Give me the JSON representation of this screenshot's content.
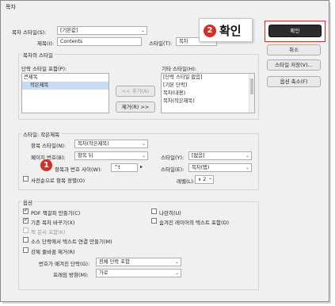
{
  "window": {
    "title": "목차"
  },
  "top": {
    "toc_style_label": "목차 스타일(S):",
    "toc_style_value": "[기본값]",
    "title_label": "제목(I):",
    "title_value": "Contents",
    "style_label": "스타일(T):",
    "style_value": "목차"
  },
  "styles_group": {
    "title": "목차의 스타일",
    "include_label": "단락 스타일 포함(P):",
    "include_items": [
      "큰제목",
      "작은제목"
    ],
    "add_button": "<< 추가(A)",
    "remove_button": "제거(R) >>",
    "other_label": "기타 스타일(H):",
    "other_items": [
      "[단락 스타일 없음]",
      "[기본 단락]",
      "목차(내용)",
      "목차(작은제목)"
    ]
  },
  "style_detail": {
    "title": "스타일: 작은제목",
    "entry_style_label": "항목 스타일(N):",
    "entry_style_value": "목차(작은제목)",
    "page_number_label": "페이지 번호(B):",
    "page_number_value": "항목 뒤",
    "style_y_label": "스타일(Y):",
    "style_y_value": "[없음]",
    "between_label": "항목과 번호 사이(W):",
    "between_value": "^t",
    "style_e_label": "스타일(E):",
    "style_e_value": "목차(탭)",
    "sort_label": "사전순으로 항목 정렬(O)",
    "level_label": "레벨(L):",
    "level_value": "2"
  },
  "options": {
    "title": "옵션",
    "pdf_bookmarks": "PDF 책갈피 만들기(C)",
    "replace_toc": "기존 목차 바꾸기(X)",
    "book_doc": "책 문서 포함(K)",
    "make_links": "소스 단락에서 텍스트 연결 만들기(M)",
    "remove_breaks": "강제 줄바꿈 제거(R)",
    "numbered_label": "번호가 매겨진 단락(G):",
    "numbered_value": "전체 단락 포함",
    "frame_label": "프레임 방향(M):",
    "frame_value": "가로",
    "run_in": "나란히(U)",
    "hidden_layers": "숨겨진 레이어의 텍스트 포함(D)"
  },
  "buttons": {
    "ok": "확인",
    "cancel": "취소",
    "save_style": "스타일 저장(V)...",
    "fewer_options": "옵션 축소(F)"
  },
  "callouts": {
    "callout_1_number": "1",
    "callout_2_number": "2",
    "callout_2_text": "확인"
  },
  "colors": {
    "accent_red": "#d32f23",
    "ok_button": "#2b2b2b"
  }
}
